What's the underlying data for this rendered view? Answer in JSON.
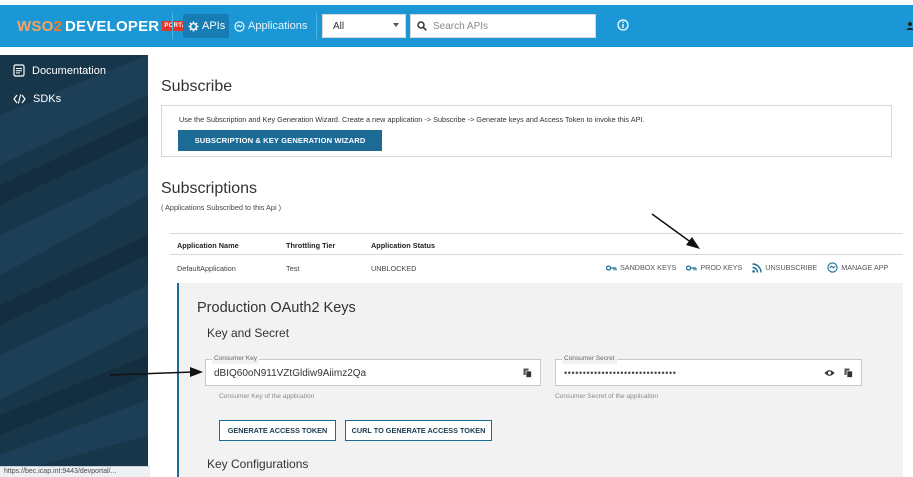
{
  "header": {
    "logo_wso": "WSO",
    "logo_two": "2",
    "logo_developer": "DEVELOPER",
    "logo_portal": "PORTAL",
    "nav_apis": "APIs",
    "nav_applications": "Applications",
    "search_scope": "All",
    "search_placeholder": "Search APIs"
  },
  "sidebar": {
    "items": [
      {
        "label": "Documentation",
        "icon": "document-icon"
      },
      {
        "label": "SDKs",
        "icon": "code-icon"
      }
    ],
    "status_url": "https://bec.icap.int:9443/devportal/..."
  },
  "subscribe": {
    "title": "Subscribe",
    "wizard_text": "Use the Subscription and Key Generation Wizard. Create a new application -> Subscribe -> Generate keys and Access Token to invoke this API.",
    "wizard_button": "SUBSCRIPTION & KEY GENERATION WIZARD"
  },
  "subscriptions": {
    "title": "Subscriptions",
    "subtitle": "( Applications Subscribed to this Api )",
    "columns": [
      "Application Name",
      "Throttling Tier",
      "Application Status"
    ],
    "rows": [
      {
        "app": "DefaultApplication",
        "tier": "Test",
        "status": "UNBLOCKED"
      }
    ],
    "actions": {
      "sandbox": "SANDBOX KEYS",
      "prod": "PROD KEYS",
      "unsubscribe": "UNSUBSCRIBE",
      "manage": "MANAGE APP"
    }
  },
  "keys": {
    "title": "Production OAuth2 Keys",
    "section": "Key and Secret",
    "consumer_key_label": "Consumer Key",
    "consumer_key_value": "dBIQ60oN911VZtGldiw9Aiimz2Qa",
    "consumer_key_hint": "Consumer Key of the application",
    "consumer_secret_label": "Consumer Secret",
    "consumer_secret_value": "••••••••••••••••••••••••••••••",
    "consumer_secret_hint": "Consumer Secret of the application",
    "generate_button": "GENERATE ACCESS TOKEN",
    "curl_button": "CURL TO GENERATE ACCESS TOKEN",
    "key_configurations": "Key Configurations"
  },
  "colors": {
    "header_blue": "#1b97d6",
    "sidebar_navy": "#18364a",
    "primary_button": "#1b6b96",
    "portal_badge": "#e5352b"
  }
}
